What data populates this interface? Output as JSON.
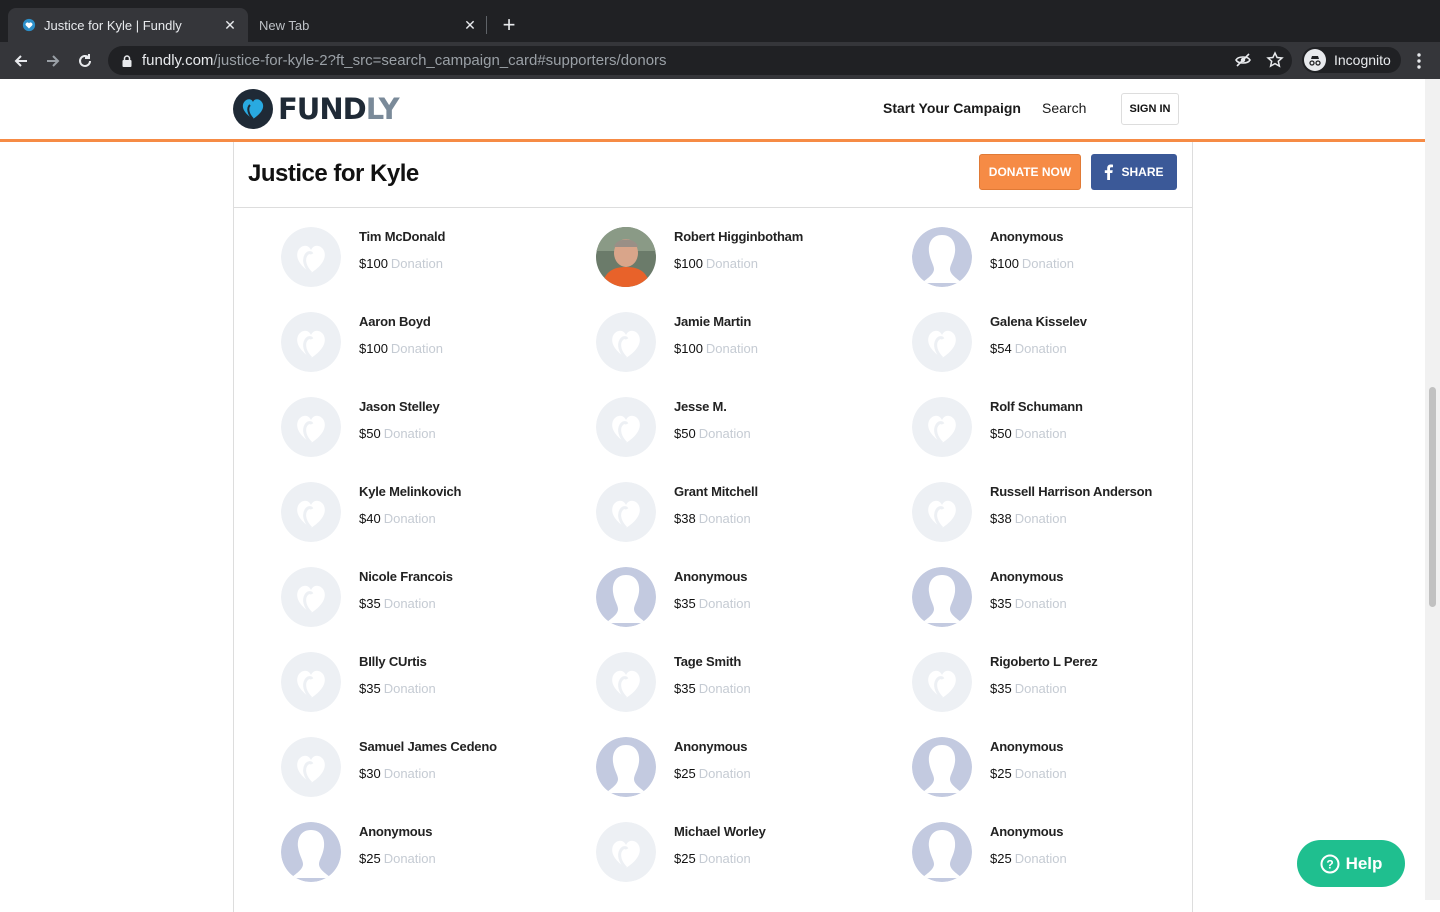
{
  "browser": {
    "tabs": [
      {
        "title": "Justice for Kyle | Fundly",
        "active": true
      },
      {
        "title": "New Tab",
        "active": false
      }
    ],
    "url_host": "fundly.com",
    "url_path": "/justice-for-kyle-2?ft_src=search_campaign_card#supporters/donors",
    "profile_label": "Incognito"
  },
  "header": {
    "logo_main": "FUND",
    "logo_accent": "LY",
    "start_campaign": "Start Your Campaign",
    "search": "Search",
    "sign_in": "SIGN IN"
  },
  "campaign": {
    "title": "Justice for Kyle",
    "donate_label": "DONATE NOW",
    "share_label": "SHARE"
  },
  "donation_label": "Donation",
  "donors": [
    {
      "name": "Tim McDonald",
      "amount": "$100",
      "avatar": "fundly-heart"
    },
    {
      "name": "Robert Higginbotham",
      "amount": "$100",
      "avatar": "photo"
    },
    {
      "name": "Anonymous",
      "amount": "$100",
      "avatar": "silhouette"
    },
    {
      "name": "Aaron Boyd",
      "amount": "$100",
      "avatar": "fundly-heart"
    },
    {
      "name": "Jamie Martin",
      "amount": "$100",
      "avatar": "fundly-heart"
    },
    {
      "name": "Galena Kisselev",
      "amount": "$54",
      "avatar": "fundly-heart"
    },
    {
      "name": "Jason Stelley",
      "amount": "$50",
      "avatar": "fundly-heart"
    },
    {
      "name": "Jesse M.",
      "amount": "$50",
      "avatar": "fundly-heart"
    },
    {
      "name": "Rolf Schumann",
      "amount": "$50",
      "avatar": "fundly-heart"
    },
    {
      "name": "Kyle Melinkovich",
      "amount": "$40",
      "avatar": "fundly-heart"
    },
    {
      "name": "Grant Mitchell",
      "amount": "$38",
      "avatar": "fundly-heart"
    },
    {
      "name": "Russell Harrison Anderson",
      "amount": "$38",
      "avatar": "fundly-heart"
    },
    {
      "name": "Nicole Francois",
      "amount": "$35",
      "avatar": "fundly-heart"
    },
    {
      "name": "Anonymous",
      "amount": "$35",
      "avatar": "silhouette"
    },
    {
      "name": "Anonymous",
      "amount": "$35",
      "avatar": "silhouette"
    },
    {
      "name": "BIlly CUrtis",
      "amount": "$35",
      "avatar": "fundly-heart"
    },
    {
      "name": "Tage Smith",
      "amount": "$35",
      "avatar": "fundly-heart"
    },
    {
      "name": "Rigoberto L Perez",
      "amount": "$35",
      "avatar": "fundly-heart"
    },
    {
      "name": "Samuel James Cedeno",
      "amount": "$30",
      "avatar": "fundly-heart"
    },
    {
      "name": "Anonymous",
      "amount": "$25",
      "avatar": "silhouette"
    },
    {
      "name": "Anonymous",
      "amount": "$25",
      "avatar": "silhouette"
    },
    {
      "name": "Anonymous",
      "amount": "$25",
      "avatar": "silhouette"
    },
    {
      "name": "Michael Worley",
      "amount": "$25",
      "avatar": "fundly-heart"
    },
    {
      "name": "Anonymous",
      "amount": "$25",
      "avatar": "silhouette"
    }
  ],
  "help_label": "Help",
  "colors": {
    "accent_orange": "#f68b45",
    "facebook_blue": "#3b5998",
    "help_green": "#1fbf8f"
  }
}
